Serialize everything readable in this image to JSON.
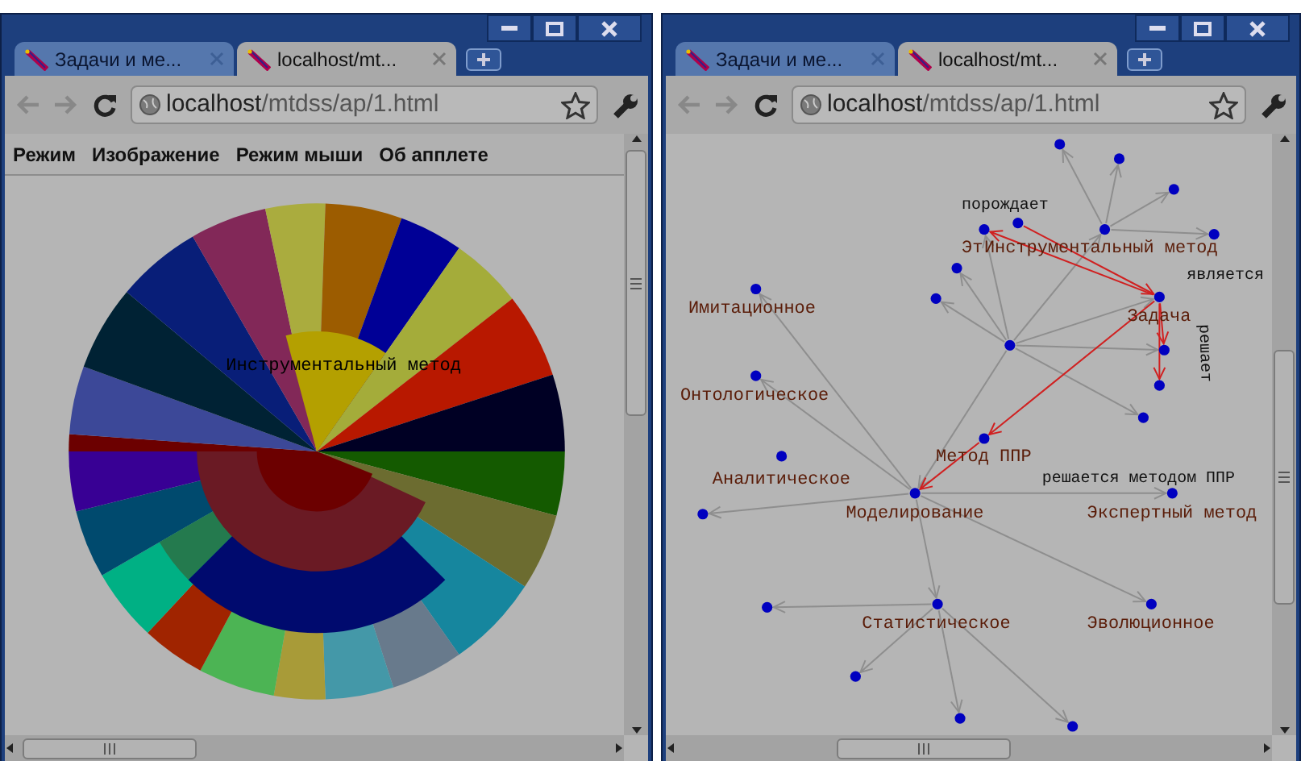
{
  "windows": [
    {
      "tabs": [
        {
          "title": "Задачи и ме...",
          "selected": false
        },
        {
          "title": "localhost/mt...",
          "selected": true
        }
      ],
      "address": {
        "host": "localhost",
        "path": "/mtdss/ap/1.html"
      },
      "menu": [
        "Режим",
        "Изображение",
        "Режим мыши",
        "Об апплете"
      ],
      "content": {
        "kind": "sunburst",
        "center_label": "Инструментальный метод"
      }
    },
    {
      "tabs": [
        {
          "title": "Задачи и ме...",
          "selected": false
        },
        {
          "title": "localhost/mt...",
          "selected": true
        }
      ],
      "address": {
        "host": "localhost",
        "path": "/mtdss/ap/1.html"
      },
      "content": {
        "kind": "graph",
        "node_labels": [
          "Эт",
          "Инструментальный метод",
          "Задача",
          "Имитационное",
          "Онтологическое",
          "Аналитическое",
          "Метод ППР",
          "Моделирование",
          "Экспертный метод",
          "Статистическое",
          "Эволюционное"
        ],
        "edge_labels": [
          "порождает",
          "является",
          "решает",
          "решается методом ППР"
        ]
      }
    }
  ]
}
